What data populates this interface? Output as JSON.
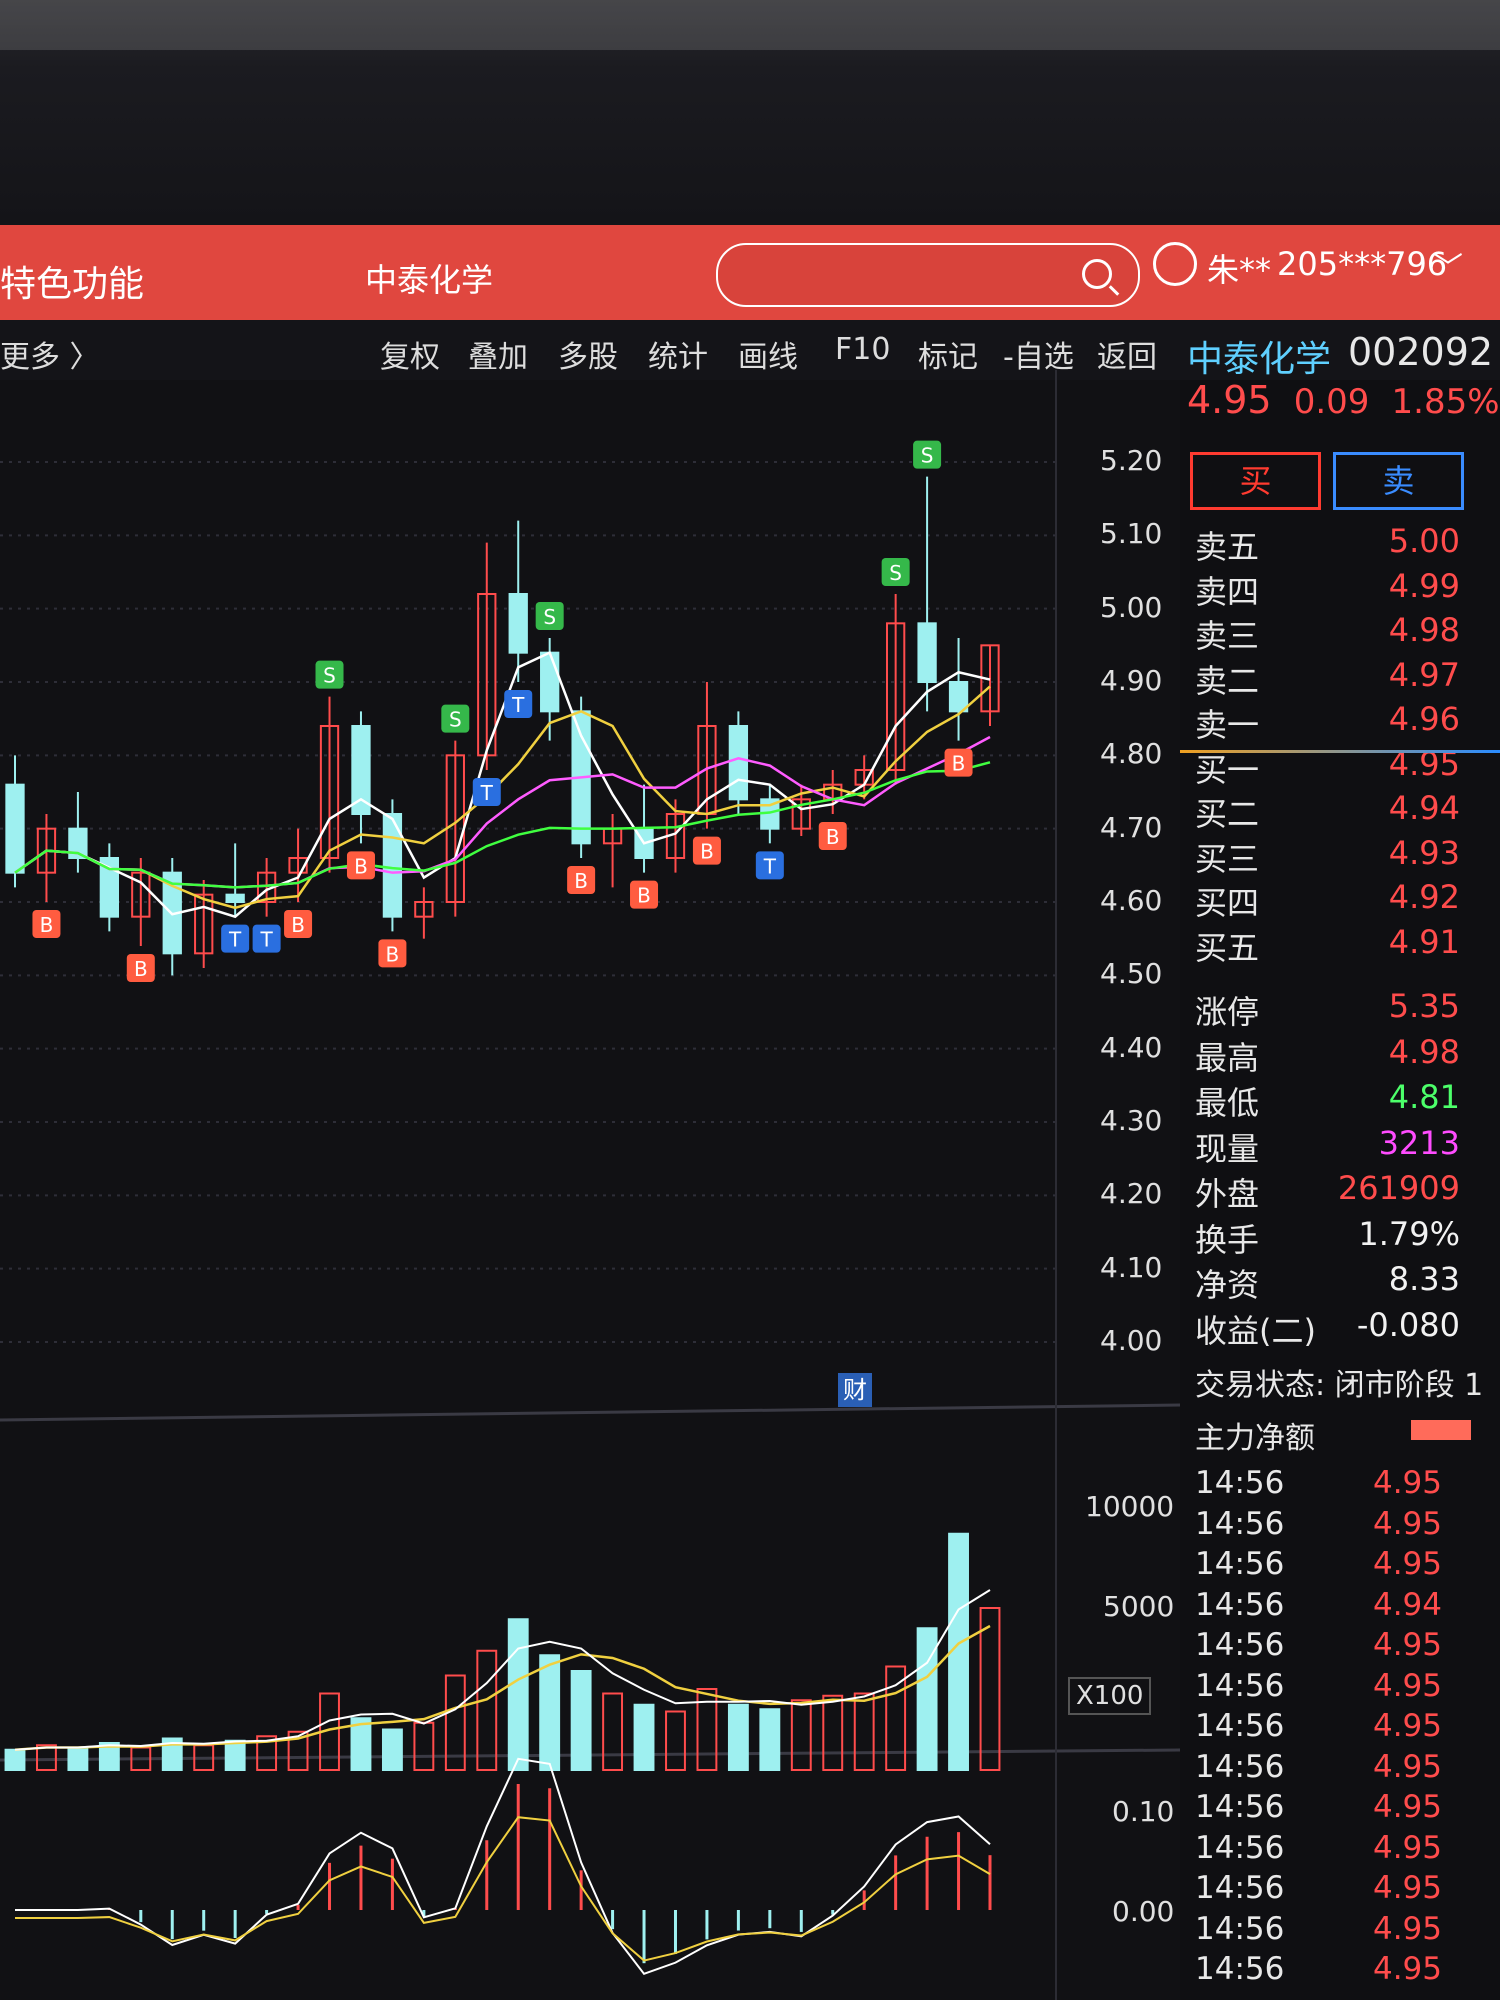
{
  "topbar": {
    "feature_label": "特色功能",
    "stock_name": "中泰化学",
    "search_placeholder": "",
    "user": "朱**",
    "account": "205***796",
    "dropdown_icon": "chevron-down-icon"
  },
  "toolbar": {
    "more_label": "更多 〉",
    "tools": [
      "复权",
      "叠加",
      "多股",
      "统计",
      "画线",
      "F10",
      "标记",
      "-自选",
      "返回"
    ],
    "stock_title": "中泰化学",
    "stock_code": "002092"
  },
  "quote": {
    "price": "4.95",
    "change": "0.09",
    "change_pct": "1.85%"
  },
  "trade_buttons": {
    "buy": "买",
    "sell": "卖"
  },
  "order_book": [
    {
      "label": "卖五",
      "value": "5.00",
      "color": "red"
    },
    {
      "label": "卖四",
      "value": "4.99",
      "color": "red"
    },
    {
      "label": "卖三",
      "value": "4.98",
      "color": "red"
    },
    {
      "label": "卖二",
      "value": "4.97",
      "color": "red"
    },
    {
      "label": "卖一",
      "value": "4.96",
      "color": "red"
    },
    {
      "label": "买一",
      "value": "4.95",
      "color": "red"
    },
    {
      "label": "买二",
      "value": "4.94",
      "color": "red"
    },
    {
      "label": "买三",
      "value": "4.93",
      "color": "red"
    },
    {
      "label": "买四",
      "value": "4.92",
      "color": "red"
    },
    {
      "label": "买五",
      "value": "4.91",
      "color": "red"
    }
  ],
  "stats": [
    {
      "label": "涨停",
      "value": "5.35",
      "color": "red"
    },
    {
      "label": "最高",
      "value": "4.98",
      "color": "red"
    },
    {
      "label": "最低",
      "value": "4.81",
      "color": "green"
    },
    {
      "label": "现量",
      "value": "3213",
      "color": "magenta"
    },
    {
      "label": "外盘",
      "value": "261909",
      "color": "red"
    },
    {
      "label": "换手",
      "value": "1.79%",
      "color": "white"
    },
    {
      "label": "净资",
      "value": "8.33",
      "color": "white"
    },
    {
      "label": "收益(二)",
      "value": "-0.080",
      "color": "white"
    }
  ],
  "status_text": "交易状态: 闭市阶段 1",
  "main_flow_label": "主力净额",
  "trades": [
    {
      "time": "14:56",
      "price": "4.95"
    },
    {
      "time": "14:56",
      "price": "4.95"
    },
    {
      "time": "14:56",
      "price": "4.95"
    },
    {
      "time": "14:56",
      "price": "4.94"
    },
    {
      "time": "14:56",
      "price": "4.95"
    },
    {
      "time": "14:56",
      "price": "4.95"
    },
    {
      "time": "14:56",
      "price": "4.95"
    },
    {
      "time": "14:56",
      "price": "4.95"
    },
    {
      "time": "14:56",
      "price": "4.95"
    },
    {
      "time": "14:56",
      "price": "4.95"
    },
    {
      "time": "14:56",
      "price": "4.95"
    },
    {
      "time": "14:56",
      "price": "4.95"
    },
    {
      "time": "14:56",
      "price": "4.95"
    }
  ],
  "price_axis": [
    "5.20",
    "5.10",
    "5.00",
    "4.90",
    "4.80",
    "4.70",
    "4.60",
    "4.50",
    "4.40",
    "4.30",
    "4.20",
    "4.10",
    "4.00"
  ],
  "volume_axis": [
    "10000",
    "5000"
  ],
  "volume_unit": "X100",
  "indicator_axis": [
    "0.10",
    "0.00"
  ],
  "finance_marker": "财",
  "colors": {
    "header_red": "#e0473f",
    "up": "#ff4c4c",
    "down": "#9ef0f0",
    "ma5": "#ffffff",
    "ma10": "#f0d040",
    "ma20": "#ff5cff",
    "ma60": "#40ff40"
  },
  "chart_data": {
    "type": "candlestick",
    "price_ylim": [
      4.0,
      5.2
    ],
    "grid": true,
    "signals": [
      "B",
      "S",
      "T"
    ],
    "candles": [
      {
        "o": 4.76,
        "h": 4.8,
        "l": 4.62,
        "c": 4.64
      },
      {
        "o": 4.64,
        "h": 4.72,
        "l": 4.6,
        "c": 4.7
      },
      {
        "o": 4.7,
        "h": 4.75,
        "l": 4.64,
        "c": 4.66
      },
      {
        "o": 4.66,
        "h": 4.68,
        "l": 4.56,
        "c": 4.58
      },
      {
        "o": 4.58,
        "h": 4.66,
        "l": 4.54,
        "c": 4.64
      },
      {
        "o": 4.64,
        "h": 4.66,
        "l": 4.5,
        "c": 4.53
      },
      {
        "o": 4.53,
        "h": 4.63,
        "l": 4.51,
        "c": 4.61
      },
      {
        "o": 4.61,
        "h": 4.68,
        "l": 4.58,
        "c": 4.6
      },
      {
        "o": 4.6,
        "h": 4.66,
        "l": 4.58,
        "c": 4.64
      },
      {
        "o": 4.64,
        "h": 4.7,
        "l": 4.6,
        "c": 4.66
      },
      {
        "o": 4.66,
        "h": 4.88,
        "l": 4.64,
        "c": 4.84
      },
      {
        "o": 4.84,
        "h": 4.86,
        "l": 4.68,
        "c": 4.72
      },
      {
        "o": 4.72,
        "h": 4.74,
        "l": 4.56,
        "c": 4.58
      },
      {
        "o": 4.58,
        "h": 4.62,
        "l": 4.55,
        "c": 4.6
      },
      {
        "o": 4.6,
        "h": 4.82,
        "l": 4.58,
        "c": 4.8
      },
      {
        "o": 4.8,
        "h": 5.09,
        "l": 4.78,
        "c": 5.02
      },
      {
        "o": 5.02,
        "h": 5.12,
        "l": 4.9,
        "c": 4.94
      },
      {
        "o": 4.94,
        "h": 4.96,
        "l": 4.82,
        "c": 4.86
      },
      {
        "o": 4.86,
        "h": 4.88,
        "l": 4.66,
        "c": 4.68
      },
      {
        "o": 4.68,
        "h": 4.72,
        "l": 4.62,
        "c": 4.7
      },
      {
        "o": 4.7,
        "h": 4.76,
        "l": 4.64,
        "c": 4.66
      },
      {
        "o": 4.66,
        "h": 4.74,
        "l": 4.64,
        "c": 4.72
      },
      {
        "o": 4.72,
        "h": 4.9,
        "l": 4.7,
        "c": 4.84
      },
      {
        "o": 4.84,
        "h": 4.86,
        "l": 4.72,
        "c": 4.74
      },
      {
        "o": 4.74,
        "h": 4.76,
        "l": 4.68,
        "c": 4.7
      },
      {
        "o": 4.7,
        "h": 4.76,
        "l": 4.69,
        "c": 4.74
      },
      {
        "o": 4.74,
        "h": 4.78,
        "l": 4.72,
        "c": 4.76
      },
      {
        "o": 4.76,
        "h": 4.8,
        "l": 4.74,
        "c": 4.78
      },
      {
        "o": 4.78,
        "h": 5.02,
        "l": 4.76,
        "c": 4.98
      },
      {
        "o": 4.98,
        "h": 5.18,
        "l": 4.86,
        "c": 4.9
      },
      {
        "o": 4.9,
        "h": 4.96,
        "l": 4.82,
        "c": 4.86
      },
      {
        "o": 4.86,
        "h": 4.95,
        "l": 4.84,
        "c": 4.95
      }
    ],
    "volume_ylim": [
      0,
      12000
    ],
    "volumes": [
      900,
      1100,
      1000,
      1200,
      1000,
      1400,
      1100,
      1300,
      1500,
      1700,
      3400,
      2300,
      1800,
      2100,
      4200,
      5300,
      6700,
      5100,
      4400,
      3400,
      2900,
      2600,
      3600,
      2900,
      2700,
      3100,
      3300,
      3400,
      4600,
      6300,
      10500,
      7200
    ]
  }
}
